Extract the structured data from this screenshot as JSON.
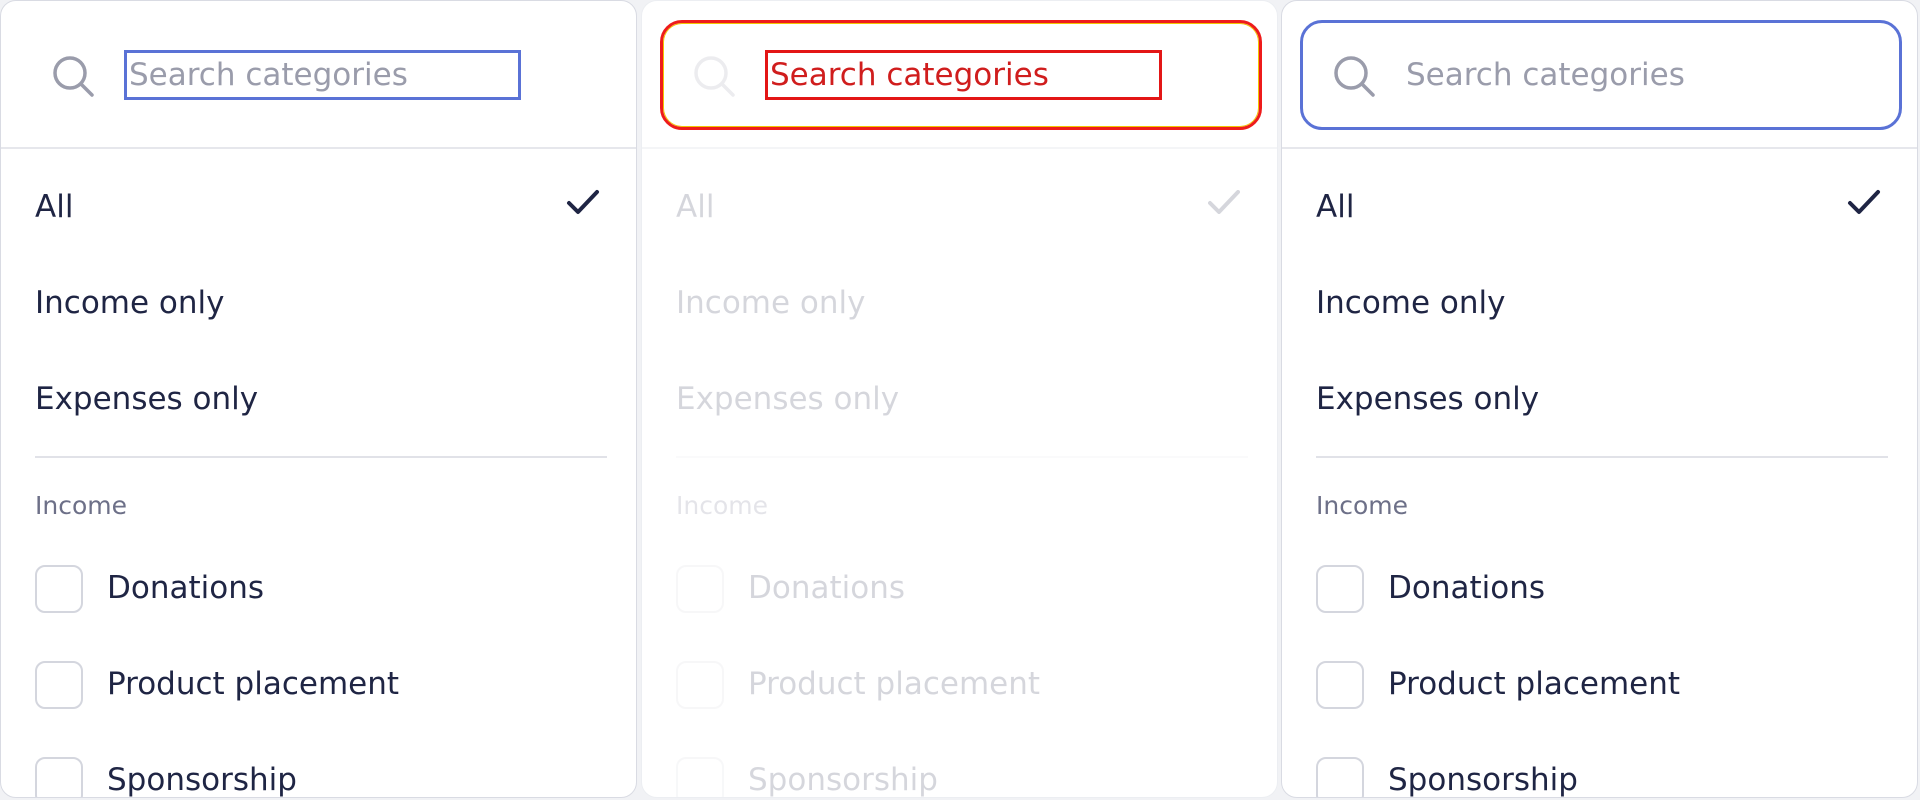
{
  "search": {
    "placeholder": "Search categories"
  },
  "filters": [
    {
      "label": "All",
      "selected": true
    },
    {
      "label": "Income only",
      "selected": false
    },
    {
      "label": "Expenses only",
      "selected": false
    }
  ],
  "section": {
    "label": "Income"
  },
  "categories": [
    {
      "label": "Donations",
      "checked": false
    },
    {
      "label": "Product placement",
      "checked": false
    },
    {
      "label": "Sponsorship",
      "checked": false
    }
  ],
  "icons": {
    "search": "search-icon",
    "check": "check-icon",
    "checkbox": "checkbox-icon"
  },
  "colors": {
    "accent": "#5a72d6",
    "error": "#e31616",
    "text": "#1f2544",
    "muted": "#6d7088"
  }
}
